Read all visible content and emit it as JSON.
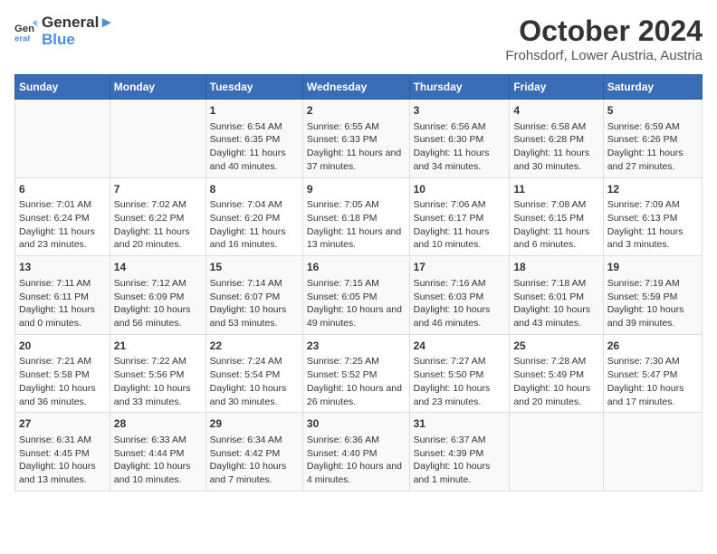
{
  "header": {
    "logo_line1": "General",
    "logo_line2": "Blue",
    "month": "October 2024",
    "location": "Frohsdorf, Lower Austria, Austria"
  },
  "weekdays": [
    "Sunday",
    "Monday",
    "Tuesday",
    "Wednesday",
    "Thursday",
    "Friday",
    "Saturday"
  ],
  "weeks": [
    [
      {
        "day": "",
        "info": ""
      },
      {
        "day": "",
        "info": ""
      },
      {
        "day": "1",
        "info": "Sunrise: 6:54 AM\nSunset: 6:35 PM\nDaylight: 11 hours and 40 minutes."
      },
      {
        "day": "2",
        "info": "Sunrise: 6:55 AM\nSunset: 6:33 PM\nDaylight: 11 hours and 37 minutes."
      },
      {
        "day": "3",
        "info": "Sunrise: 6:56 AM\nSunset: 6:30 PM\nDaylight: 11 hours and 34 minutes."
      },
      {
        "day": "4",
        "info": "Sunrise: 6:58 AM\nSunset: 6:28 PM\nDaylight: 11 hours and 30 minutes."
      },
      {
        "day": "5",
        "info": "Sunrise: 6:59 AM\nSunset: 6:26 PM\nDaylight: 11 hours and 27 minutes."
      }
    ],
    [
      {
        "day": "6",
        "info": "Sunrise: 7:01 AM\nSunset: 6:24 PM\nDaylight: 11 hours and 23 minutes."
      },
      {
        "day": "7",
        "info": "Sunrise: 7:02 AM\nSunset: 6:22 PM\nDaylight: 11 hours and 20 minutes."
      },
      {
        "day": "8",
        "info": "Sunrise: 7:04 AM\nSunset: 6:20 PM\nDaylight: 11 hours and 16 minutes."
      },
      {
        "day": "9",
        "info": "Sunrise: 7:05 AM\nSunset: 6:18 PM\nDaylight: 11 hours and 13 minutes."
      },
      {
        "day": "10",
        "info": "Sunrise: 7:06 AM\nSunset: 6:17 PM\nDaylight: 11 hours and 10 minutes."
      },
      {
        "day": "11",
        "info": "Sunrise: 7:08 AM\nSunset: 6:15 PM\nDaylight: 11 hours and 6 minutes."
      },
      {
        "day": "12",
        "info": "Sunrise: 7:09 AM\nSunset: 6:13 PM\nDaylight: 11 hours and 3 minutes."
      }
    ],
    [
      {
        "day": "13",
        "info": "Sunrise: 7:11 AM\nSunset: 6:11 PM\nDaylight: 11 hours and 0 minutes."
      },
      {
        "day": "14",
        "info": "Sunrise: 7:12 AM\nSunset: 6:09 PM\nDaylight: 10 hours and 56 minutes."
      },
      {
        "day": "15",
        "info": "Sunrise: 7:14 AM\nSunset: 6:07 PM\nDaylight: 10 hours and 53 minutes."
      },
      {
        "day": "16",
        "info": "Sunrise: 7:15 AM\nSunset: 6:05 PM\nDaylight: 10 hours and 49 minutes."
      },
      {
        "day": "17",
        "info": "Sunrise: 7:16 AM\nSunset: 6:03 PM\nDaylight: 10 hours and 46 minutes."
      },
      {
        "day": "18",
        "info": "Sunrise: 7:18 AM\nSunset: 6:01 PM\nDaylight: 10 hours and 43 minutes."
      },
      {
        "day": "19",
        "info": "Sunrise: 7:19 AM\nSunset: 5:59 PM\nDaylight: 10 hours and 39 minutes."
      }
    ],
    [
      {
        "day": "20",
        "info": "Sunrise: 7:21 AM\nSunset: 5:58 PM\nDaylight: 10 hours and 36 minutes."
      },
      {
        "day": "21",
        "info": "Sunrise: 7:22 AM\nSunset: 5:56 PM\nDaylight: 10 hours and 33 minutes."
      },
      {
        "day": "22",
        "info": "Sunrise: 7:24 AM\nSunset: 5:54 PM\nDaylight: 10 hours and 30 minutes."
      },
      {
        "day": "23",
        "info": "Sunrise: 7:25 AM\nSunset: 5:52 PM\nDaylight: 10 hours and 26 minutes."
      },
      {
        "day": "24",
        "info": "Sunrise: 7:27 AM\nSunset: 5:50 PM\nDaylight: 10 hours and 23 minutes."
      },
      {
        "day": "25",
        "info": "Sunrise: 7:28 AM\nSunset: 5:49 PM\nDaylight: 10 hours and 20 minutes."
      },
      {
        "day": "26",
        "info": "Sunrise: 7:30 AM\nSunset: 5:47 PM\nDaylight: 10 hours and 17 minutes."
      }
    ],
    [
      {
        "day": "27",
        "info": "Sunrise: 6:31 AM\nSunset: 4:45 PM\nDaylight: 10 hours and 13 minutes."
      },
      {
        "day": "28",
        "info": "Sunrise: 6:33 AM\nSunset: 4:44 PM\nDaylight: 10 hours and 10 minutes."
      },
      {
        "day": "29",
        "info": "Sunrise: 6:34 AM\nSunset: 4:42 PM\nDaylight: 10 hours and 7 minutes."
      },
      {
        "day": "30",
        "info": "Sunrise: 6:36 AM\nSunset: 4:40 PM\nDaylight: 10 hours and 4 minutes."
      },
      {
        "day": "31",
        "info": "Sunrise: 6:37 AM\nSunset: 4:39 PM\nDaylight: 10 hours and 1 minute."
      },
      {
        "day": "",
        "info": ""
      },
      {
        "day": "",
        "info": ""
      }
    ]
  ]
}
